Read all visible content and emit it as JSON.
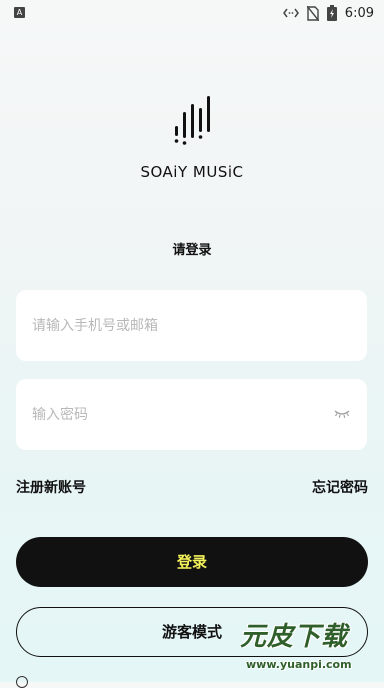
{
  "status_bar": {
    "notification_icon_label": "A",
    "time": "6:09",
    "icons": [
      "notification-icon",
      "data-saver-icon",
      "no-sim-icon",
      "battery-charging-icon"
    ]
  },
  "brand": {
    "logo_icon": "sound-wave-logo-icon",
    "name": "SOAiY MUSiC"
  },
  "login": {
    "title": "请登录",
    "phone_placeholder": "请输入手机号或邮箱",
    "password_placeholder": "输入密码",
    "password_toggle_icon": "eye-closed-icon",
    "register_link": "注册新账号",
    "forgot_link": "忘记密码",
    "login_button": "登录",
    "guest_button": "游客模式"
  },
  "watermark": {
    "text": "元皮下载",
    "url": "www.yuanpi.com"
  },
  "colors": {
    "button_bg": "#111111",
    "login_text": "#f2f15a",
    "field_bg": "#ffffff",
    "placeholder": "#b8b8b8"
  }
}
